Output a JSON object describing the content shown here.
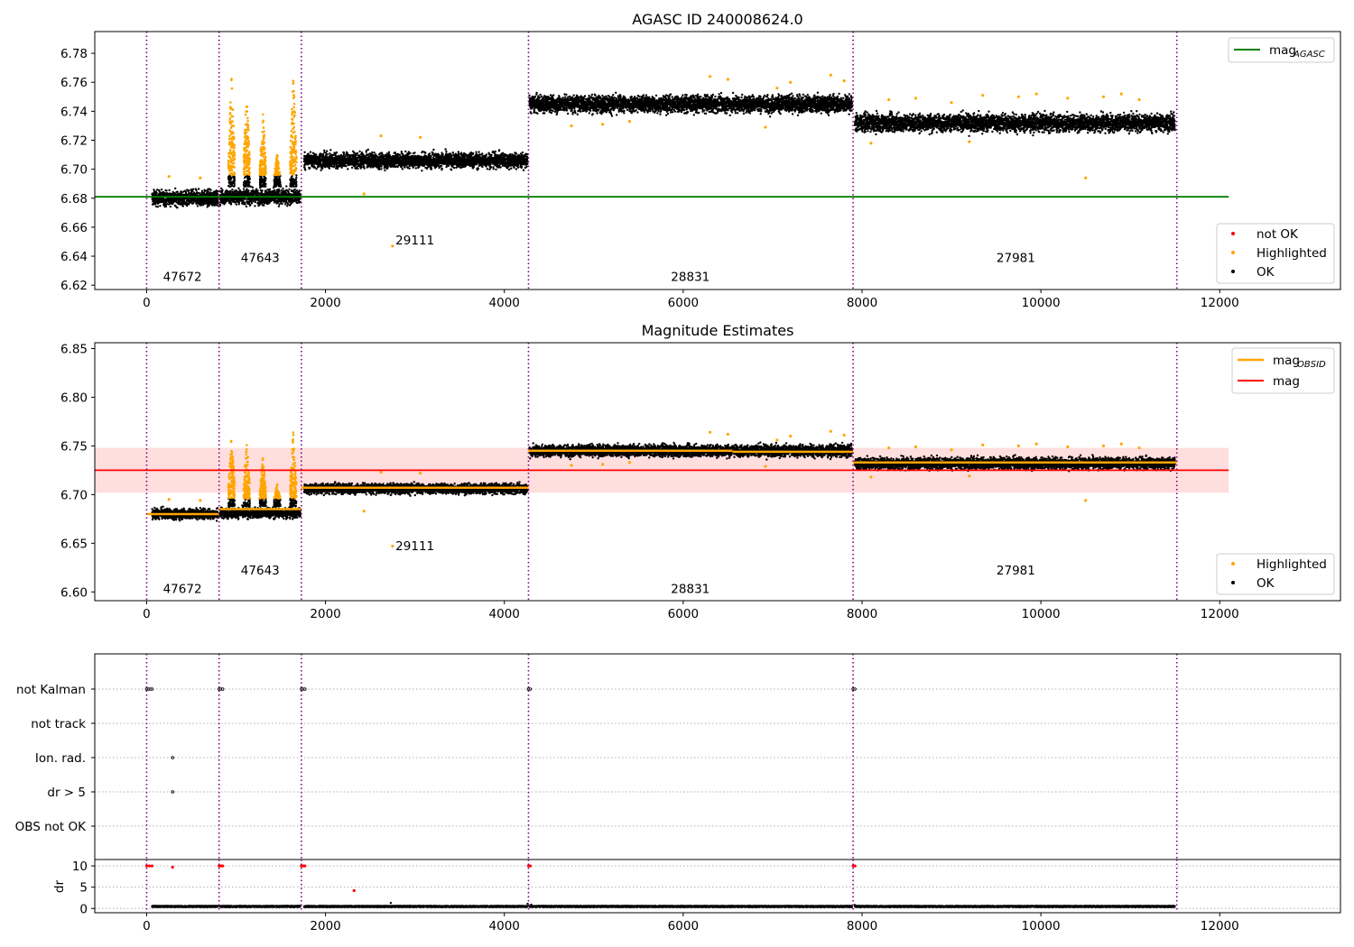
{
  "chart_data": [
    {
      "type": "scatter",
      "title": "AGASC ID 240008624.0",
      "xlim": [
        -580,
        13350
      ],
      "ylim": [
        6.617,
        6.795
      ],
      "xticks": [
        0,
        2000,
        4000,
        6000,
        8000,
        10000,
        12000
      ],
      "yticks": [
        6.62,
        6.64,
        6.66,
        6.68,
        6.7,
        6.72,
        6.74,
        6.76,
        6.78
      ],
      "ytick_labels": [
        "6.62",
        "6.64",
        "6.66",
        "6.68",
        "6.70",
        "6.72",
        "6.74",
        "6.76",
        "6.78"
      ],
      "vlines": [
        0,
        810,
        1730,
        4270,
        7900,
        11520
      ],
      "hline": {
        "label": "mag",
        "sub": "AGASC",
        "y": 6.681,
        "xmin": -580,
        "xmax": 12100,
        "color": "#008000"
      },
      "segments": [
        {
          "x0": 60,
          "x1": 800,
          "mean": 6.68,
          "spread": 0.004
        },
        {
          "x0": 820,
          "x1": 1720,
          "mean": 6.681,
          "spread": 0.004
        },
        {
          "x0": 1760,
          "x1": 4260,
          "mean": 6.706,
          "spread": 0.004
        },
        {
          "x0": 4280,
          "x1": 7890,
          "mean": 6.745,
          "spread": 0.0045
        },
        {
          "x0": 7920,
          "x1": 11500,
          "mean": 6.732,
          "spread": 0.0045
        }
      ],
      "highlight_spikes": [
        {
          "x": 950,
          "top": 6.766
        },
        {
          "x": 1120,
          "top": 6.756
        },
        {
          "x": 1300,
          "top": 6.74
        },
        {
          "x": 1460,
          "top": 6.712
        },
        {
          "x": 1640,
          "top": 6.766
        }
      ],
      "highlight_points": [
        [
          250,
          6.695
        ],
        [
          600,
          6.694
        ],
        [
          2430,
          6.683
        ],
        [
          2620,
          6.723
        ],
        [
          2750,
          6.647
        ],
        [
          3060,
          6.722
        ],
        [
          4750,
          6.73
        ],
        [
          5100,
          6.731
        ],
        [
          5400,
          6.733
        ],
        [
          6300,
          6.764
        ],
        [
          6500,
          6.762
        ],
        [
          6920,
          6.729
        ],
        [
          7050,
          6.756
        ],
        [
          7200,
          6.76
        ],
        [
          7650,
          6.765
        ],
        [
          7800,
          6.761
        ],
        [
          8100,
          6.718
        ],
        [
          8300,
          6.748
        ],
        [
          8600,
          6.749
        ],
        [
          9000,
          6.746
        ],
        [
          9200,
          6.719
        ],
        [
          9350,
          6.751
        ],
        [
          9750,
          6.75
        ],
        [
          9950,
          6.752
        ],
        [
          10300,
          6.749
        ],
        [
          10500,
          6.694
        ],
        [
          10700,
          6.75
        ],
        [
          10900,
          6.752
        ],
        [
          11100,
          6.748
        ]
      ],
      "obsid_labels": [
        {
          "text": "47672",
          "x": 400,
          "y": 6.623
        },
        {
          "text": "47643",
          "x": 1270,
          "y": 6.636
        },
        {
          "text": "29111",
          "x": 3000,
          "y": 6.648
        },
        {
          "text": "28831",
          "x": 6080,
          "y": 6.623
        },
        {
          "text": "27981",
          "x": 9720,
          "y": 6.636
        }
      ],
      "legend_upper": [
        {
          "label": "mag",
          "sub": "AGASC",
          "color": "#008000",
          "kind": "line"
        }
      ],
      "legend_lower": [
        {
          "label": "not OK",
          "color": "#ff0000",
          "kind": "dot"
        },
        {
          "label": "Highlighted",
          "color": "#ffa500",
          "kind": "dot"
        },
        {
          "label": "OK",
          "color": "#000000",
          "kind": "dot"
        }
      ]
    },
    {
      "type": "scatter",
      "title": "Magnitude Estimates",
      "xlim": [
        -580,
        13350
      ],
      "ylim": [
        6.591,
        6.856
      ],
      "xticks": [
        0,
        2000,
        4000,
        6000,
        8000,
        10000,
        12000
      ],
      "yticks": [
        6.6,
        6.65,
        6.7,
        6.75,
        6.8,
        6.85
      ],
      "ytick_labels": [
        "6.60",
        "6.65",
        "6.70",
        "6.75",
        "6.80",
        "6.85"
      ],
      "vlines": [
        0,
        810,
        1730,
        4270,
        7900,
        11520
      ],
      "mag": {
        "value": 6.725,
        "band": [
          6.702,
          6.748
        ],
        "xmin": -580,
        "xmax": 12100,
        "color": "#ff0000"
      },
      "obsid_mags": [
        {
          "x0": 0,
          "x1": 810,
          "mag": 6.68
        },
        {
          "x0": 810,
          "x1": 1730,
          "mag": 6.685
        },
        {
          "x0": 1730,
          "x1": 4270,
          "mag": 6.707
        },
        {
          "x0": 4270,
          "x1": 6550,
          "mag": 6.745
        },
        {
          "x0": 6550,
          "x1": 7900,
          "mag": 6.744
        },
        {
          "x0": 7900,
          "x1": 11520,
          "mag": 6.733
        }
      ],
      "segments": [
        {
          "x0": 60,
          "x1": 800,
          "mean": 6.68,
          "spread": 0.004
        },
        {
          "x0": 820,
          "x1": 1720,
          "mean": 6.681,
          "spread": 0.004
        },
        {
          "x0": 1760,
          "x1": 4260,
          "mean": 6.706,
          "spread": 0.004
        },
        {
          "x0": 4280,
          "x1": 7890,
          "mean": 6.745,
          "spread": 0.0045
        },
        {
          "x0": 7920,
          "x1": 11500,
          "mean": 6.732,
          "spread": 0.0045
        }
      ],
      "highlight_spikes": [
        {
          "x": 950,
          "top": 6.766
        },
        {
          "x": 1120,
          "top": 6.756
        },
        {
          "x": 1300,
          "top": 6.74
        },
        {
          "x": 1460,
          "top": 6.712
        },
        {
          "x": 1640,
          "top": 6.766
        }
      ],
      "highlight_points": [
        [
          250,
          6.695
        ],
        [
          600,
          6.694
        ],
        [
          2430,
          6.683
        ],
        [
          2620,
          6.723
        ],
        [
          2750,
          6.647
        ],
        [
          3060,
          6.722
        ],
        [
          4750,
          6.73
        ],
        [
          5100,
          6.731
        ],
        [
          5400,
          6.733
        ],
        [
          6300,
          6.764
        ],
        [
          6500,
          6.762
        ],
        [
          6920,
          6.729
        ],
        [
          7050,
          6.756
        ],
        [
          7200,
          6.76
        ],
        [
          7650,
          6.765
        ],
        [
          7800,
          6.761
        ],
        [
          8100,
          6.718
        ],
        [
          8300,
          6.748
        ],
        [
          8600,
          6.749
        ],
        [
          9000,
          6.746
        ],
        [
          9200,
          6.719
        ],
        [
          9350,
          6.751
        ],
        [
          9750,
          6.75
        ],
        [
          9950,
          6.752
        ],
        [
          10300,
          6.749
        ],
        [
          10500,
          6.694
        ],
        [
          10700,
          6.75
        ],
        [
          10900,
          6.752
        ],
        [
          11100,
          6.748
        ]
      ],
      "obsid_labels": [
        {
          "text": "47672",
          "x": 400,
          "y": 6.599
        },
        {
          "text": "47643",
          "x": 1270,
          "y": 6.618
        },
        {
          "text": "29111",
          "x": 3000,
          "y": 6.643
        },
        {
          "text": "28831",
          "x": 6080,
          "y": 6.599
        },
        {
          "text": "27981",
          "x": 9720,
          "y": 6.618
        }
      ],
      "legend_upper": [
        {
          "label": "mag",
          "sub": "OBSID",
          "color": "#ffa500",
          "kind": "line"
        },
        {
          "label": "mag",
          "sub": "",
          "color": "#ff0000",
          "kind": "line"
        }
      ],
      "legend_lower": [
        {
          "label": "Highlighted",
          "color": "#ffa500",
          "kind": "dot"
        },
        {
          "label": "OK",
          "color": "#000000",
          "kind": "dot"
        }
      ]
    },
    {
      "type": "scatter",
      "title": "",
      "xlim": [
        -580,
        13350
      ],
      "flag_categories": [
        "not Kalman",
        "not track",
        "Ion. rad.",
        "dr > 5",
        "OBS not OK"
      ],
      "flag_points": [
        {
          "flag": "not Kalman",
          "x": [
            0,
            20,
            40,
            60,
            810,
            830,
            850,
            1730,
            1750,
            1770,
            4270,
            4290,
            7900,
            7920
          ]
        },
        {
          "flag": "Ion. rad.",
          "x": [
            290
          ]
        },
        {
          "flag": "dr > 5",
          "x": [
            290
          ]
        }
      ],
      "vlines": [
        0,
        810,
        1730,
        4270,
        7900,
        11520
      ],
      "dr": {
        "ylabel": "dr",
        "ylim": [
          -1,
          11.5
        ],
        "yticks": [
          0,
          5,
          10
        ],
        "ytick_labels": [
          "0",
          "5",
          "10"
        ],
        "baseline": 0.3,
        "red_points": [
          [
            0,
            10
          ],
          [
            30,
            10
          ],
          [
            60,
            10
          ],
          [
            810,
            10
          ],
          [
            830,
            10
          ],
          [
            850,
            10
          ],
          [
            1730,
            10
          ],
          [
            1750,
            10
          ],
          [
            1770,
            10
          ],
          [
            4270,
            10
          ],
          [
            4290,
            10
          ],
          [
            7900,
            10
          ],
          [
            7920,
            10
          ],
          [
            290,
            9.7
          ],
          [
            2320,
            4.2
          ]
        ],
        "black_points": [
          [
            2730,
            1.3
          ],
          [
            4260,
            1.1
          ],
          [
            4300,
            0.9
          ],
          [
            7920,
            0.8
          ]
        ]
      },
      "xticks": [
        0,
        2000,
        4000,
        6000,
        8000,
        10000,
        12000
      ]
    }
  ]
}
